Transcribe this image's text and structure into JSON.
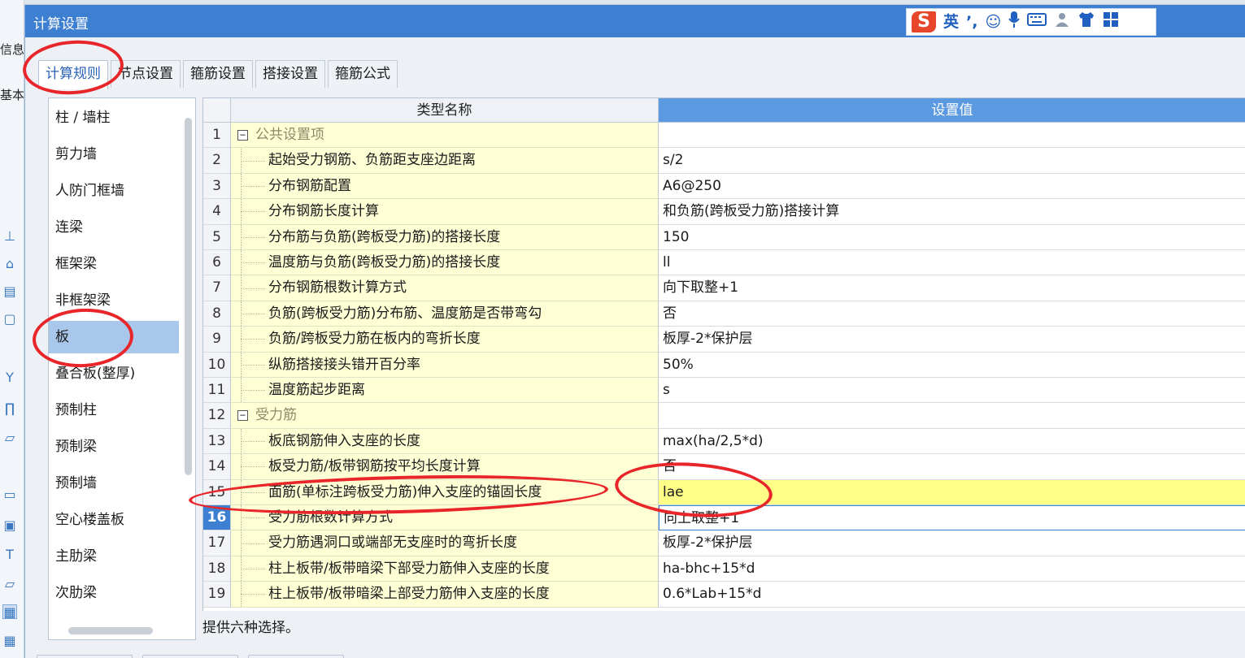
{
  "background_app": {
    "labels": [
      "信息",
      "基本"
    ],
    "icon_names": [
      "building-icon",
      "home-icon",
      "wall-icon",
      "frame-icon",
      "column-icon",
      "arch-icon",
      "slab-icon",
      "beam-icon",
      "stair-icon",
      "board-icon",
      "board-alt-icon"
    ]
  },
  "dialog": {
    "title": "计算设置"
  },
  "ime_toolbar": {
    "logo": "S",
    "lang": "英",
    "icons": [
      "punctuation-icon",
      "emoji-icon",
      "microphone-icon",
      "keyboard-icon",
      "user-icon",
      "skin-icon",
      "grid-icon"
    ],
    "punct": "’,",
    "emoji": "☺",
    "mic": "🎤",
    "keyboard": "⌨",
    "user": "♣",
    "shirt": "👕",
    "grid": "▦"
  },
  "tabs": [
    {
      "label": "计算规则",
      "active": true
    },
    {
      "label": "节点设置",
      "active": false
    },
    {
      "label": "箍筋设置",
      "active": false
    },
    {
      "label": "搭接设置",
      "active": false
    },
    {
      "label": "箍筋公式",
      "active": false
    }
  ],
  "categories": [
    {
      "label": "柱 / 墙柱"
    },
    {
      "label": "剪力墙"
    },
    {
      "label": "人防门框墙"
    },
    {
      "label": "连梁"
    },
    {
      "label": "框架梁"
    },
    {
      "label": "非框架梁"
    },
    {
      "label": "板",
      "active": true
    },
    {
      "label": "叠合板(整厚)"
    },
    {
      "label": "预制柱"
    },
    {
      "label": "预制梁"
    },
    {
      "label": "预制墙"
    },
    {
      "label": "空心楼盖板"
    },
    {
      "label": "主肋梁"
    },
    {
      "label": "次肋梁"
    }
  ],
  "grid": {
    "col_name": "类型名称",
    "col_value": "设置值",
    "toggle_symbol": "−",
    "rows": [
      {
        "n": "1",
        "name": "公共设置项",
        "value": "",
        "group": true
      },
      {
        "n": "2",
        "name": "起始受力钢筋、负筋距支座边距离",
        "value": "s/2"
      },
      {
        "n": "3",
        "name": "分布钢筋配置",
        "value": "A6@250"
      },
      {
        "n": "4",
        "name": "分布钢筋长度计算",
        "value": "和负筋(跨板受力筋)搭接计算"
      },
      {
        "n": "5",
        "name": "分布筋与负筋(跨板受力筋)的搭接长度",
        "value": "150"
      },
      {
        "n": "6",
        "name": "温度筋与负筋(跨板受力筋)的搭接长度",
        "value": "ll"
      },
      {
        "n": "7",
        "name": "分布钢筋根数计算方式",
        "value": "向下取整+1"
      },
      {
        "n": "8",
        "name": "负筋(跨板受力筋)分布筋、温度筋是否带弯勾",
        "value": "否"
      },
      {
        "n": "9",
        "name": "负筋/跨板受力筋在板内的弯折长度",
        "value": "板厚-2*保护层"
      },
      {
        "n": "10",
        "name": "纵筋搭接接头错开百分率",
        "value": "50%"
      },
      {
        "n": "11",
        "name": "温度筋起步距离",
        "value": "s"
      },
      {
        "n": "12",
        "name": "受力筋",
        "value": "",
        "group": true
      },
      {
        "n": "13",
        "name": "板底钢筋伸入支座的长度",
        "value": "max(ha/2,5*d)"
      },
      {
        "n": "14",
        "name": "板受力筋/板带钢筋按平均长度计算",
        "value": "否"
      },
      {
        "n": "15",
        "name": "面筋(单标注跨板受力筋)伸入支座的锚固长度",
        "value": "lae",
        "highlight": true
      },
      {
        "n": "16",
        "name": "受力筋根数计算方式",
        "value": "向上取整+1",
        "selected": true
      },
      {
        "n": "17",
        "name": "受力筋遇洞口或端部无支座时的弯折长度",
        "value": "板厚-2*保护层"
      },
      {
        "n": "18",
        "name": "柱上板带/板带暗梁下部受力筋伸入支座的长度",
        "value": "ha-bhc+15*d"
      },
      {
        "n": "19",
        "name": "柱上板带/板带暗梁上部受力筋伸入支座的长度",
        "value": "0.6*Lab+15*d"
      }
    ]
  },
  "description": "提供六种选择。",
  "annotation_color": "#e8262a"
}
